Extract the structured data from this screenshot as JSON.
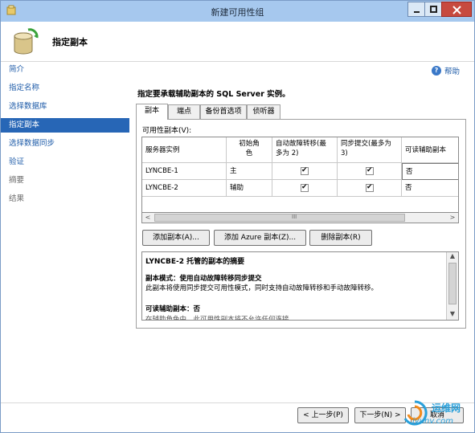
{
  "window": {
    "title": "新建可用性组"
  },
  "header": {
    "title": "指定副本"
  },
  "nav": {
    "items": [
      {
        "label": "简介",
        "state": "link"
      },
      {
        "label": "指定名称",
        "state": "link"
      },
      {
        "label": "选择数据库",
        "state": "link"
      },
      {
        "label": "指定副本",
        "state": "active"
      },
      {
        "label": "选择数据同步",
        "state": "link"
      },
      {
        "label": "验证",
        "state": "link"
      },
      {
        "label": "摘要",
        "state": "disabled"
      },
      {
        "label": "结果",
        "state": "disabled"
      }
    ]
  },
  "help": {
    "label": "帮助",
    "icon": "help-icon"
  },
  "main": {
    "instruction": "指定要承载辅助副本的 SQL Server 实例。",
    "tabs": [
      "副本",
      "端点",
      "备份首选项",
      "侦听器"
    ],
    "grid_label": "可用性副本(V):",
    "columns": [
      "服务器实例",
      "初始角色",
      "自动故障转移(最多为 2)",
      "同步提交(最多为 3)",
      "可读辅助副本"
    ],
    "column_lines": [
      [
        "服务器实例"
      ],
      [
        "初始角",
        "色"
      ],
      [
        "自动故障转移(最",
        "多为 2)"
      ],
      [
        "同步提交(最多为",
        "3)"
      ],
      [
        "可读辅助副本"
      ]
    ],
    "rows": [
      {
        "server": "LYNCBE-1",
        "role": "主",
        "auto_failover": true,
        "sync_commit": true,
        "readable": "否"
      },
      {
        "server": "LYNCBE-2",
        "role": "辅助",
        "auto_failover": true,
        "sync_commit": true,
        "readable": "否"
      }
    ],
    "scroll_arrows": {
      "left": "<",
      "right": ">",
      "grip": "III"
    },
    "buttons": {
      "add_replica": "添加副本(A)...",
      "add_azure": "添加 Azure 副本(Z)...",
      "remove_replica": "删除副本(R)"
    },
    "summary": {
      "title": "LYNCBE-2 托管的副本的摘要",
      "mode_label": "副本模式：使用自动故障转移同步提交",
      "mode_desc": "此副本将使用同步提交可用性模式，同时支持自动故障转移和手动故障转移。",
      "readable_label": "可读辅助副本：否",
      "readable_desc": "在辅助角色中，此可用性副本将不允许任何连接。"
    }
  },
  "footer": {
    "prev": "< 上一步(P)",
    "next": "下一步(N) >",
    "cancel": "取消"
  },
  "watermark": {
    "line1": "运维网",
    "line2": "iyunv.com"
  },
  "colors": {
    "titlebar": "#a6c8ee",
    "nav_active": "#2766b6",
    "link": "#1e5ba8"
  }
}
